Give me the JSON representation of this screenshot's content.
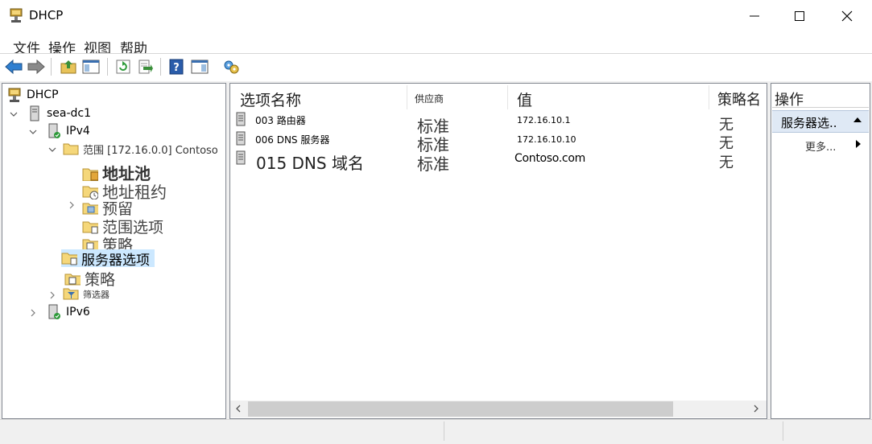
{
  "window": {
    "title": "DHCP",
    "icon": "dhcp-icon"
  },
  "window_controls": [
    "minimize-icon",
    "maximize-icon",
    "close-icon"
  ],
  "menu": [
    "文件",
    "操作",
    "视图",
    "帮助"
  ],
  "toolbar": {
    "buttons": [
      "back-arrow-icon",
      "forward-arrow-icon",
      "up-folder-icon",
      "show-hide-tree-icon",
      "refresh-icon",
      "export-list-icon",
      "help-icon",
      "show-hide-action-pane-icon",
      "server-options-icon"
    ]
  },
  "tree": {
    "root": "DHCP",
    "server": "sea-dc1",
    "ipv4": "IPv4",
    "scope": "范围 [172.16.0.0] Contoso",
    "address_pool": "地址池",
    "address_leases": "地址租约",
    "reservations": "预留",
    "scope_options": "范围选项",
    "scope_policies": "策略",
    "server_options": "服务器选项",
    "policies": "策略",
    "filters": "筛选器",
    "ipv6": "IPv6"
  },
  "list": {
    "columns": [
      "选项名称",
      "供应商",
      "值",
      "策略名"
    ],
    "rows": [
      {
        "name": "003 路由器",
        "vendor": "标准",
        "value": "172.16.10.1",
        "policy": "无"
      },
      {
        "name": "006 DNS 服务器",
        "vendor": "标准",
        "value": "172.16.10.10",
        "policy": "无"
      },
      {
        "name": "015 DNS 域名",
        "vendor": "标准",
        "value": "Contoso.com",
        "policy": "无"
      }
    ]
  },
  "actions": {
    "title": "操作",
    "section": "服务器选..",
    "more": "更多..."
  },
  "colors": {
    "selection": "#cce8ff",
    "action_header": "#dfe9f5",
    "border": "#828790"
  }
}
